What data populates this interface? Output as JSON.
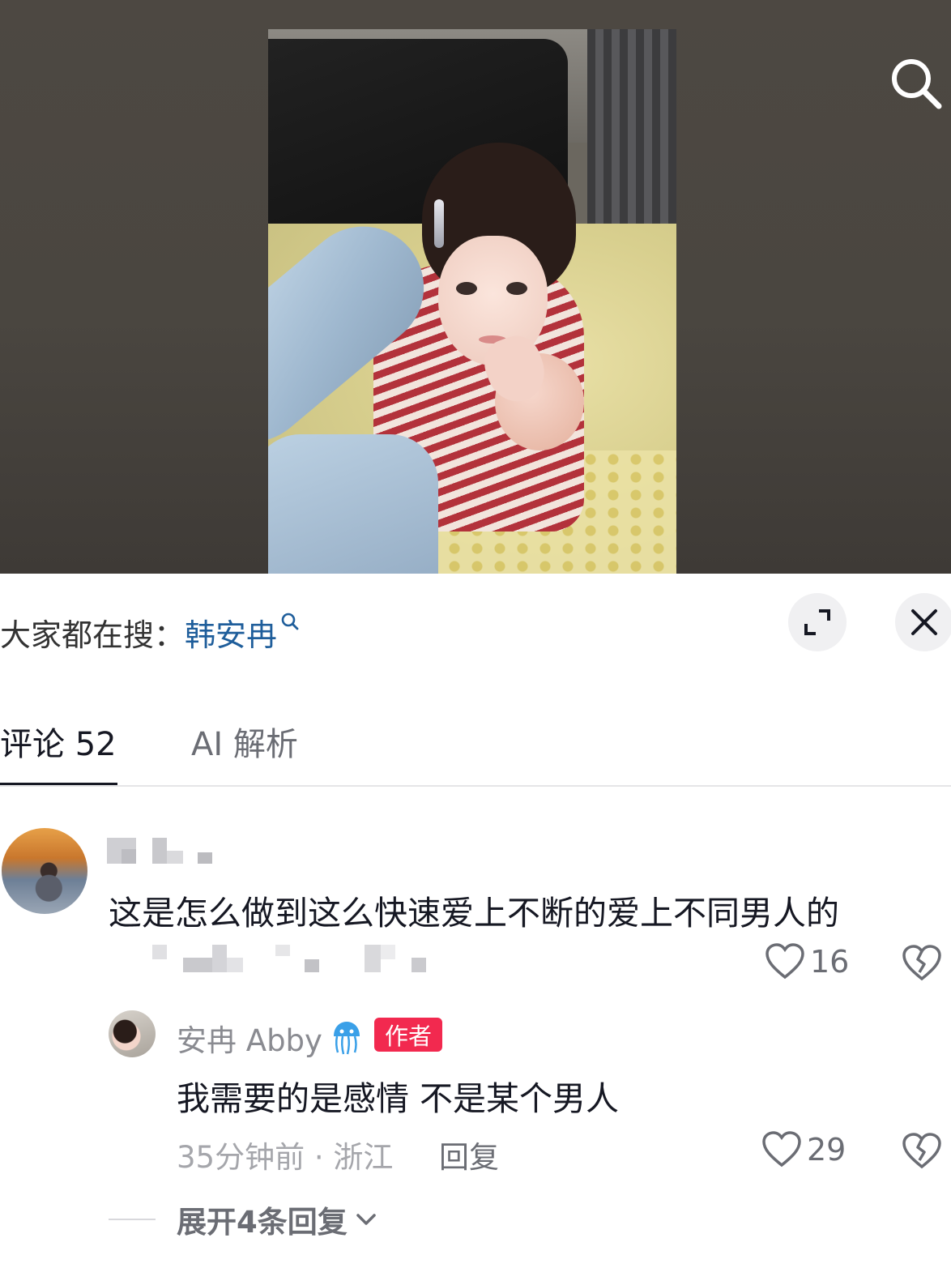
{
  "media": {
    "search_icon": "search-icon"
  },
  "suggest": {
    "prefix": "大家都在搜：",
    "keyword": "韩安冉",
    "expand_icon": "expand-icon",
    "close_icon": "close-icon"
  },
  "tabs": [
    {
      "label": "评论 52",
      "active": true
    },
    {
      "label": "AI 解析",
      "active": false
    }
  ],
  "comment": {
    "text": "这是怎么做到这么快速爱上不断的爱上不同男人的",
    "likes": "16",
    "reply": {
      "name": "安冉 Abby",
      "badge": "作者",
      "text": "我需要的是感情 不是某个男人",
      "meta": "35分钟前 · 浙江",
      "reply_label": "回复",
      "likes": "29"
    },
    "expand_label": "展开4条回复"
  },
  "colors": {
    "keyword": "#1f5e9b",
    "author_badge": "#f2294f",
    "text_primary": "#161823",
    "text_secondary": "#6b6d74"
  }
}
